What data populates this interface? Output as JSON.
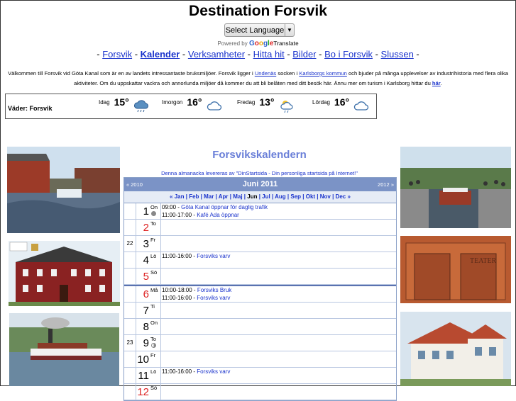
{
  "site_title": "Destination Forsvik",
  "language": {
    "select_label": "Select Language",
    "arrow": "▼"
  },
  "powered_by": {
    "prefix": "Powered by",
    "google": [
      "G",
      "o",
      "o",
      "g",
      "l",
      "e"
    ],
    "suffix": "Translate"
  },
  "nav": [
    {
      "label": "Forsvik",
      "active": false
    },
    {
      "label": "Kalender",
      "active": true
    },
    {
      "label": "Verksamheter",
      "active": false
    },
    {
      "label": "Hitta hit",
      "active": false
    },
    {
      "label": "Bilder",
      "active": false
    },
    {
      "label": "Bo i Forsvik",
      "active": false
    },
    {
      "label": "Slussen",
      "active": false
    }
  ],
  "intro": {
    "p1": "Välkommen till Forsvik vid Göta Kanal som är en av landets intressantaste bruksmiljöer. Forsvik ligger i ",
    "link1": "Undenäs",
    "p2": " socken i ",
    "link2": "Karlsborgs kommun",
    "p3": " och bjuder på många upplevelser av industrihistoria med flera olika aktiviteter. Om du uppskattar vackra och annorlunda miljöer då kommer du att bli belåten med ditt besök här. Ännu mer om turism i Karlsborg hittar du ",
    "link3": "här",
    "p4": "."
  },
  "weather": {
    "location": "Väder: Forsvik",
    "days": [
      {
        "name": "Idag",
        "temp": "15°",
        "icon": "rain-cloud-icon"
      },
      {
        "name": "Imorgon",
        "temp": "16°",
        "icon": "cloud-icon"
      },
      {
        "name": "Fredag",
        "temp": "13°",
        "icon": "sun-cloud-rain-icon"
      },
      {
        "name": "Lördag",
        "temp": "16°",
        "icon": "cloud-icon"
      }
    ]
  },
  "calendar": {
    "title": "Forsvikskalendern",
    "note": "Denna almanacka levereras av \"DinStartsida - Din personliga startsida på Internet!\"",
    "prev": "« 2010",
    "next": "2012 »",
    "month": "Juni 2011",
    "months_line": [
      "«",
      "Jan",
      "Feb",
      "Mar",
      "Apr",
      "Maj",
      "Jun",
      "Jul",
      "Aug",
      "Sep",
      "Okt",
      "Nov",
      "Dec",
      "»"
    ],
    "current_month": "Jun",
    "days": [
      {
        "week": "",
        "num": "1",
        "name": "On",
        "red": false,
        "moon": "full",
        "events": [
          {
            "time": "09:00 - ",
            "title": "Göta Kanal öppnar för daglig trafik"
          },
          {
            "time": "11:00-17:00 - ",
            "title": "Kafé Ada öppnar"
          }
        ]
      },
      {
        "week": "",
        "num": "2",
        "name": "To",
        "red": true,
        "moon": "",
        "events": []
      },
      {
        "week": "22",
        "num": "3",
        "name": "Fr",
        "red": false,
        "moon": "",
        "events": []
      },
      {
        "week": "",
        "num": "4",
        "name": "Lö",
        "red": false,
        "moon": "",
        "events": [
          {
            "time": "11:00-16:00 - ",
            "title": "Forsviks varv"
          }
        ]
      },
      {
        "week": "",
        "num": "5",
        "name": "Sö",
        "red": true,
        "moon": "",
        "events": []
      },
      {
        "week": "",
        "num": "6",
        "name": "Må",
        "red": true,
        "moon": "",
        "week_start": true,
        "events": [
          {
            "time": "10:00-18:00 - ",
            "title": "Forsviks Bruk"
          },
          {
            "time": "11:00-16:00 - ",
            "title": "Forsviks varv"
          }
        ]
      },
      {
        "week": "",
        "num": "7",
        "name": "Ti",
        "red": false,
        "moon": "",
        "events": []
      },
      {
        "week": "",
        "num": "8",
        "name": "On",
        "red": false,
        "moon": "",
        "events": []
      },
      {
        "week": "23",
        "num": "9",
        "name": "To",
        "red": false,
        "moon": "half",
        "events": []
      },
      {
        "week": "",
        "num": "10",
        "name": "Fr",
        "red": false,
        "moon": "",
        "events": []
      },
      {
        "week": "",
        "num": "11",
        "name": "Lö",
        "red": false,
        "moon": "",
        "events": [
          {
            "time": "11:00-16:00 - ",
            "title": "Forsviks varv"
          }
        ]
      },
      {
        "week": "",
        "num": "12",
        "name": "Sö",
        "red": true,
        "moon": "",
        "events": []
      }
    ]
  }
}
